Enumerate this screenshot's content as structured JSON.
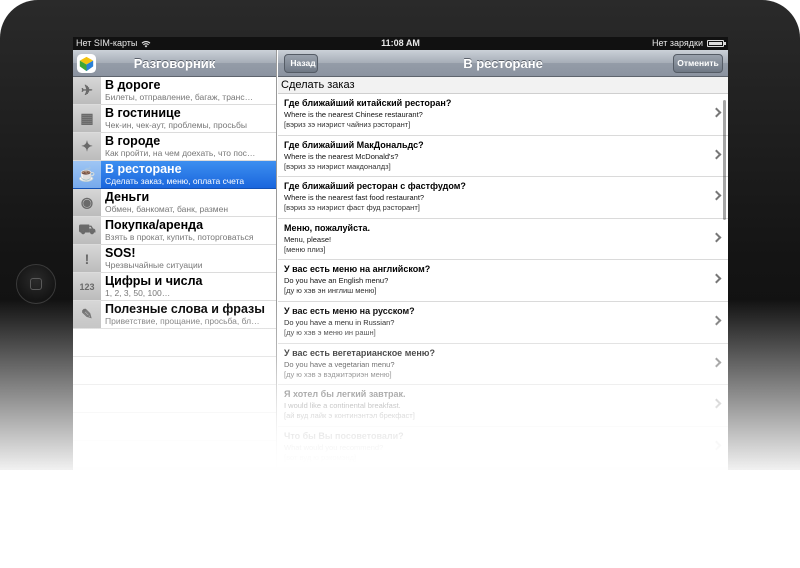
{
  "status": {
    "carrier": "Нет SIM-карты",
    "time": "11:08 AM",
    "battery": "Нет зарядки"
  },
  "left": {
    "title": "Разговорник",
    "items": [
      {
        "title": "В дороге",
        "sub": "Билеты, отправление, багаж, транс…",
        "icon": "airplane-icon",
        "glyph": "✈"
      },
      {
        "title": "В гостинице",
        "sub": "Чек-ин, чек-аут, проблемы, просьбы",
        "icon": "hotel-icon",
        "glyph": "▦"
      },
      {
        "title": "В городе",
        "sub": "Как пройти, на чем доехать, что пос…",
        "icon": "compass-icon",
        "glyph": "✦"
      },
      {
        "title": "В ресторане",
        "sub": "Сделать заказ, меню, оплата счета",
        "icon": "waiter-icon",
        "glyph": "☕"
      },
      {
        "title": "Деньги",
        "sub": "Обмен, банкомат, банк, размен",
        "icon": "coins-icon",
        "glyph": "◉"
      },
      {
        "title": "Покупка/аренда",
        "sub": "Взять в прокат, купить, поторговаться",
        "icon": "cart-icon",
        "glyph": "⛟"
      },
      {
        "title": "SOS!",
        "sub": "Чрезвычайные ситуации",
        "icon": "exclamation-icon",
        "glyph": "!"
      },
      {
        "title": "Цифры и числа",
        "sub": "1, 2, 3, 50, 100…",
        "icon": "numbers-icon",
        "glyph": "123"
      },
      {
        "title": "Полезные слова и фразы",
        "sub": "Приветствие, прощание, просьба, бл…",
        "icon": "notepad-icon",
        "glyph": "✎"
      }
    ]
  },
  "right": {
    "back_label": "Назад",
    "title": "В ресторане",
    "cancel_label": "Отменить",
    "section": "Сделать заказ",
    "phrases": [
      {
        "ru": "Где ближайший китайский ресторан?",
        "en": "Where is the nearest Chinese restaurant?",
        "tr": "[вэриз зэ ниэрист чайниз рэсторант]"
      },
      {
        "ru": "Где ближайший МакДональдс?",
        "en": "Where is the nearest  McDonald's?",
        "tr": "[вэриз зэ ниэрист макдоналдз]"
      },
      {
        "ru": "Где ближайший ресторан с фастфудом?",
        "en": "Where is the nearest  fast food restaurant?",
        "tr": "[вэриз зэ ниэрист фаст фуд рэсторант]"
      },
      {
        "ru": "Меню, пожалуйста.",
        "en": "Menu, please!",
        "tr": "[меню плиз]"
      },
      {
        "ru": "У вас есть меню на английском?",
        "en": "Do you have an English menu?",
        "tr": "[ду ю хэв эн инглиш меню]"
      },
      {
        "ru": "У вас есть меню на русском?",
        "en": "Do you have a menu in Russian?",
        "tr": "[ду ю хэв э меню ин рашн]"
      },
      {
        "ru": "У вас есть вегетарианское меню?",
        "en": "Do you have a vegetarian menu?",
        "tr": "[ду ю хэв э вэджитэриэн меню]"
      },
      {
        "ru": "Я хотел бы легкий завтрак.",
        "en": "I would like a continental breakfast.",
        "tr": "[ай вуд лайк э континэнтэл брекфаст]"
      },
      {
        "ru": "Что бы Вы посоветовали?",
        "en": "What would  you recommend?",
        "tr": "[вот вуд ю рэкомэнд]"
      }
    ]
  },
  "colors": {
    "selection": "#1a66dd",
    "navbar": "#949ca8"
  }
}
